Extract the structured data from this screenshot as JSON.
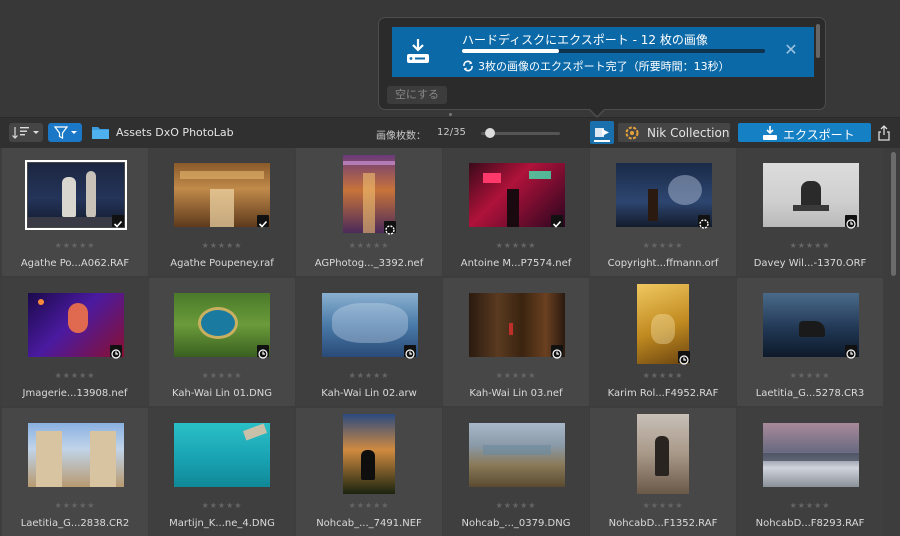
{
  "export_panel": {
    "title": "ハードディスクにエクスポート - 12 枚の画像",
    "progress": 0.32,
    "status": "3枚の画像のエクスポート完了（所要時間：13秒）",
    "clear_label": "空にする"
  },
  "toolbar": {
    "folder_name": "Assets DxO PhotoLab",
    "count_label": "画像枚数：",
    "count_value": "12/35",
    "thumbnail_size": 0.12,
    "nik_label": "Nik Collection",
    "export_label": "エクスポート"
  },
  "stars_text": "★★★★★",
  "colors": {
    "accent": "#1580c4",
    "queue": "#1a6fad",
    "job_bg": "#0c69a8"
  },
  "images": [
    {
      "name": "Agathe Po...A062.RAF",
      "status": "exported",
      "thumb": "portrait"
    },
    {
      "name": "Agathe Poupeney.raf",
      "status": "exported",
      "thumb": "landscape"
    },
    {
      "name": "AGPhotog..._3392.nef",
      "status": "exporting",
      "thumb": "tall"
    },
    {
      "name": "Antoine M...P7574.nef",
      "status": "exported",
      "thumb": "landscape"
    },
    {
      "name": "Copyright...ffmann.orf",
      "status": "exporting",
      "thumb": "landscape"
    },
    {
      "name": "Davey Wil...-1370.ORF",
      "status": "queued",
      "thumb": "landscape"
    },
    {
      "name": "Jmagerie...13908.nef",
      "status": "queued",
      "thumb": "landscape"
    },
    {
      "name": "Kah-Wai Lin 01.DNG",
      "status": "queued",
      "thumb": "landscape"
    },
    {
      "name": "Kah-Wai Lin 02.arw",
      "status": "queued",
      "thumb": "landscape"
    },
    {
      "name": "Kah-Wai Lin 03.nef",
      "status": "queued",
      "thumb": "landscape"
    },
    {
      "name": "Karim Rol...F4952.RAF",
      "status": "queued",
      "thumb": "tall"
    },
    {
      "name": "Laetitia_G...5278.CR3",
      "status": "queued",
      "thumb": "landscape"
    },
    {
      "name": "Laetitia_G...2838.CR2",
      "status": "none",
      "thumb": "landscape"
    },
    {
      "name": "Martijn_K...ne_4.DNG",
      "status": "none",
      "thumb": "landscape"
    },
    {
      "name": "Nohcab_..._7491.NEF",
      "status": "none",
      "thumb": "tall"
    },
    {
      "name": "Nohcab_..._0379.DNG",
      "status": "none",
      "thumb": "landscape"
    },
    {
      "name": "NohcabD...F1352.RAF",
      "status": "none",
      "thumb": "tall"
    },
    {
      "name": "NohcabD...F8293.RAF",
      "status": "none",
      "thumb": "landscape"
    }
  ]
}
